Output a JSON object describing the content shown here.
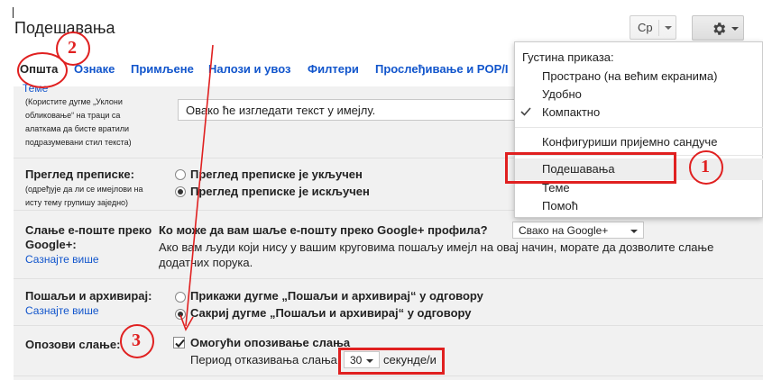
{
  "header": {
    "title": "Подешавања",
    "language_label": "Ср"
  },
  "tabs": [
    {
      "label": "Општа"
    },
    {
      "label": "Ознаке"
    },
    {
      "label": "Примљене"
    },
    {
      "label": "Налози и увоз"
    },
    {
      "label": "Филтери"
    },
    {
      "label": "Прослеђивање и POP/I"
    }
  ],
  "rows": {
    "themes": {
      "link": "Теме",
      "help": [
        "(Користите дугме „Уклони",
        "обликовање“ на траци са",
        "алаткама да бисте вратили",
        "подразумевани стил текста)"
      ],
      "sample_text": "Овако ће изгледати текст у имејлу."
    },
    "conversation": {
      "label": "Преглед преписке:",
      "help": [
        "(одређује да ли се имејлови на",
        "исту тему групишу заједно)"
      ],
      "option_on": "Преглед преписке је укључен",
      "option_off": "Преглед преписке је искључен"
    },
    "gplus": {
      "label_line1": "Слање е-поште преко",
      "label_line2": "Google+:",
      "learn_more": "Сазнајте више",
      "question": "Ко може да вам шаље е-пошту преко Google+ профила?",
      "select_value": "Свако на Google+",
      "desc_line1": "Ако вам људи који нису у вашим круговима пошаљу имејл на овај начин, морате да дозволите слање",
      "desc_line2": "додатних порука."
    },
    "send_archive": {
      "label": "Пошаљи и архивирај:",
      "learn_more": "Сазнајте више",
      "option_show": "Прикажи дугме „Пошаљи и архивирај“ у одговору",
      "option_hide": "Сакриј дугме „Пошаљи и архивирај“ у одговору"
    },
    "undo_send": {
      "label": "Опозови слање:",
      "checkbox_label": "Омогући опозивање слања",
      "period_label": "Период отказивања слања:",
      "period_value": "30",
      "period_unit": "секунде/и"
    }
  },
  "menu": {
    "heading": "Густина приказа:",
    "density_options": [
      "Пространo (на већим екранима)",
      "Удобно",
      "Компактно"
    ],
    "configure_inbox": "Конфигуриши пријемно сандуче",
    "settings": "Подешавања",
    "themes": "Теме",
    "help": "Помоћ"
  },
  "annotations": [
    "1",
    "2",
    "3"
  ],
  "colors": {
    "link": "#1155cc",
    "annotation_red": "#e02020",
    "content_bg": "#f1f1f1"
  }
}
